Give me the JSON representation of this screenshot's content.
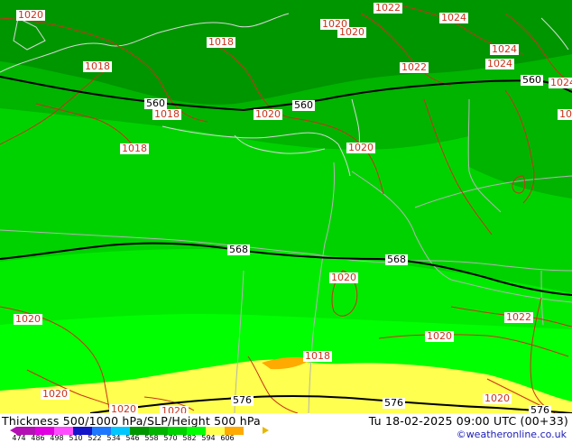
{
  "map": {
    "isobar_labels": [
      {
        "text": "1020",
        "id": "1020-a"
      },
      {
        "text": "1022",
        "id": "1022-a"
      },
      {
        "text": "1020",
        "id": "1020-b"
      },
      {
        "text": "1024",
        "id": "1024-a"
      },
      {
        "text": "1020",
        "id": "1020-c"
      },
      {
        "text": "1018",
        "id": "1018-a"
      },
      {
        "text": "1018",
        "id": "1018-b"
      },
      {
        "text": "1022",
        "id": "1022-b"
      },
      {
        "text": "1024",
        "id": "1024-b"
      },
      {
        "text": "1024",
        "id": "1024-c"
      },
      {
        "text": "1024",
        "id": "1024-d"
      },
      {
        "text": "1018",
        "id": "1018-c"
      },
      {
        "text": "1020",
        "id": "1020-d"
      },
      {
        "text": "1018",
        "id": "1018-d"
      },
      {
        "text": "1020",
        "id": "1020-e"
      },
      {
        "text": "1020",
        "id": "1020-f"
      },
      {
        "text": "1020",
        "id": "1020-g"
      },
      {
        "text": "1022",
        "id": "1022-c"
      },
      {
        "text": "1020",
        "id": "1020-h"
      },
      {
        "text": "1018",
        "id": "1018-e"
      },
      {
        "text": "1020",
        "id": "1020-i"
      },
      {
        "text": "1020",
        "id": "1020-j"
      },
      {
        "text": "1020",
        "id": "1020-k"
      },
      {
        "text": "1020",
        "id": "1020-l"
      },
      {
        "text": "102",
        "id": "102-m"
      }
    ],
    "contour_labels": [
      {
        "text": "560",
        "id": "560-a"
      },
      {
        "text": "560",
        "id": "560-b"
      },
      {
        "text": "560",
        "id": "560-c"
      },
      {
        "text": "568",
        "id": "568-a"
      },
      {
        "text": "568",
        "id": "568-b"
      },
      {
        "text": "576",
        "id": "576-a"
      },
      {
        "text": "576",
        "id": "576-b"
      },
      {
        "text": "576",
        "id": "576-c"
      }
    ]
  },
  "footer": {
    "title": "Thickness 500/1000 hPa/SLP/Height 500 hPa",
    "datetime": "Tu 18-02-2025 09:00 UTC (00+33)",
    "credit": "©weatheronline.co.uk"
  },
  "legend": {
    "values": [
      "474",
      "486",
      "498",
      "510",
      "522",
      "534",
      "546",
      "558",
      "570",
      "582",
      "594",
      "606"
    ],
    "colors": [
      "#b40fb4",
      "#e000e0",
      "#ff4cff",
      "#1414c8",
      "#1e78ff",
      "#00c8ff",
      "#009600",
      "#00b400",
      "#00d200",
      "#00ff00",
      "#ffff50",
      "#ffaa00"
    ]
  },
  "colors": {
    "dark_green": "#009600",
    "mid_green": "#00b400",
    "green": "#00d200",
    "bright_green": "#00ff00",
    "yellow": "#ffff50",
    "isobar": "#c8331a",
    "border": "#b4b4b4"
  }
}
